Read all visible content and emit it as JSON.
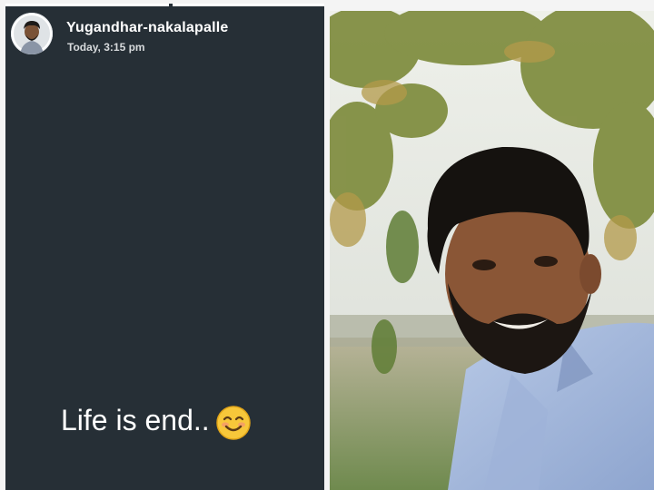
{
  "story": {
    "username": "Yugandhar-nakalapalle",
    "timestamp": "Today, 3:15 pm",
    "caption": "Life is end..",
    "caption_emoji": "smiling-face-emoji",
    "progress": 1.0,
    "background_color": "#262f36"
  },
  "photo": {
    "subject": "portrait-photo"
  }
}
